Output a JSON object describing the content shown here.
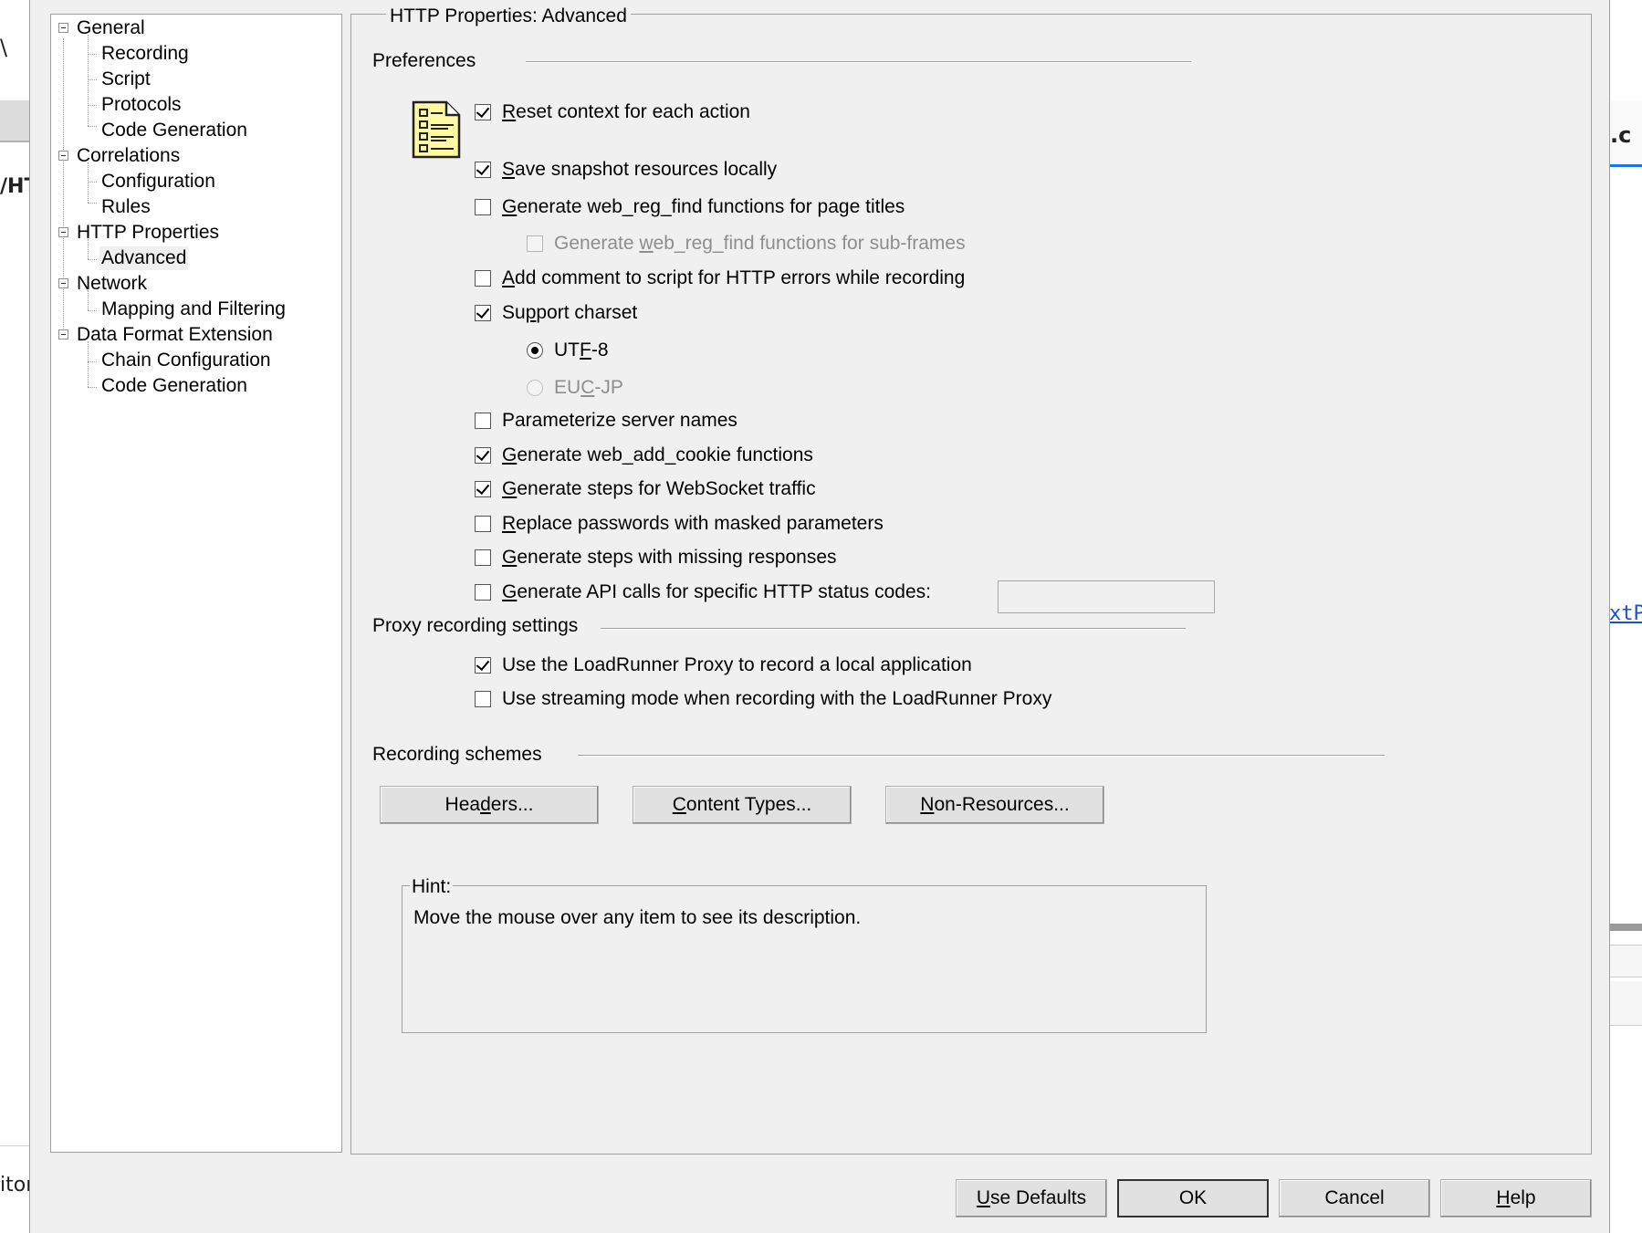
{
  "background": {
    "left_fragment_1": "\\",
    "left_fragment_2": "/HT",
    "left_fragment_3": "itor",
    "right_fragment_1": ".c",
    "right_fragment_2": "xtP"
  },
  "tree": {
    "nodes": [
      {
        "label": "General"
      },
      {
        "label": "Recording"
      },
      {
        "label": "Script"
      },
      {
        "label": "Protocols"
      },
      {
        "label": "Code Generation"
      },
      {
        "label": "Correlations"
      },
      {
        "label": "Configuration"
      },
      {
        "label": "Rules"
      },
      {
        "label": "HTTP Properties"
      },
      {
        "label": "Advanced"
      },
      {
        "label": "Network"
      },
      {
        "label": "Mapping and Filtering"
      },
      {
        "label": "Data Format Extension"
      },
      {
        "label": "Chain Configuration"
      },
      {
        "label": "Code Generation"
      }
    ],
    "selected": "Advanced"
  },
  "panel": {
    "title": "HTTP Properties: Advanced",
    "preferences_label": "Preferences",
    "icon": "document-checklist-icon",
    "preferences": [
      {
        "pre": "",
        "key": "R",
        "post": "eset context for each action",
        "checked": true,
        "disabled": false
      },
      {
        "pre": "",
        "key": "S",
        "post": "ave snapshot resources locally",
        "checked": true,
        "disabled": false
      },
      {
        "pre": "",
        "key": "G",
        "post": "enerate web_reg_find functions for page titles",
        "checked": false,
        "disabled": false
      },
      {
        "pre": "Generate ",
        "key": "w",
        "post": "eb_reg_find functions for sub-frames",
        "checked": false,
        "disabled": true
      },
      {
        "pre": "",
        "key": "A",
        "post": "dd comment to script for HTTP errors while recording",
        "checked": false,
        "disabled": false
      },
      {
        "pre": "Su",
        "key": "p",
        "post": "port charset",
        "checked": true,
        "disabled": false
      },
      {
        "pre": "Parameterize server names",
        "key": "",
        "post": "",
        "checked": false,
        "disabled": false
      },
      {
        "pre": "",
        "key": "G",
        "post": "enerate web_add_cookie functions",
        "checked": true,
        "disabled": false
      },
      {
        "pre": "",
        "key": "G",
        "post": "enerate steps for WebSocket traffic",
        "checked": true,
        "disabled": false
      },
      {
        "pre": "",
        "key": "R",
        "post": "eplace passwords with masked parameters",
        "checked": false,
        "disabled": false
      },
      {
        "pre": "",
        "key": "G",
        "post": "enerate steps with missing responses",
        "checked": false,
        "disabled": false
      },
      {
        "pre": "",
        "key": "G",
        "post": "enerate API calls for specific HTTP status codes:",
        "checked": false,
        "disabled": false
      }
    ],
    "charset_options": [
      {
        "pre": "UT",
        "key": "F",
        "post": "-8",
        "checked": true,
        "disabled": false
      },
      {
        "pre": "EU",
        "key": "C",
        "post": "-JP",
        "checked": false,
        "disabled": true
      }
    ],
    "status_codes_value": "",
    "proxy_label": "Proxy recording settings",
    "proxy": [
      {
        "label": "Use the LoadRunner Proxy to record a local application",
        "checked": true
      },
      {
        "label": "Use streaming mode when recording with the LoadRunner Proxy",
        "checked": false
      }
    ],
    "schemes_label": "Recording schemes",
    "scheme_buttons": [
      {
        "pre": "Hea",
        "key": "d",
        "post": "ers..."
      },
      {
        "pre": "",
        "key": "C",
        "post": "ontent Types..."
      },
      {
        "pre": "",
        "key": "N",
        "post": "on-Resources..."
      }
    ],
    "hint_label": "Hint:",
    "hint_text": "Move the mouse over any item to see its description."
  },
  "footer": {
    "use_defaults": {
      "pre": "",
      "key": "U",
      "post": "se Defaults"
    },
    "ok": "OK",
    "cancel": "Cancel",
    "help": {
      "pre": "",
      "key": "H",
      "post": "elp"
    }
  }
}
